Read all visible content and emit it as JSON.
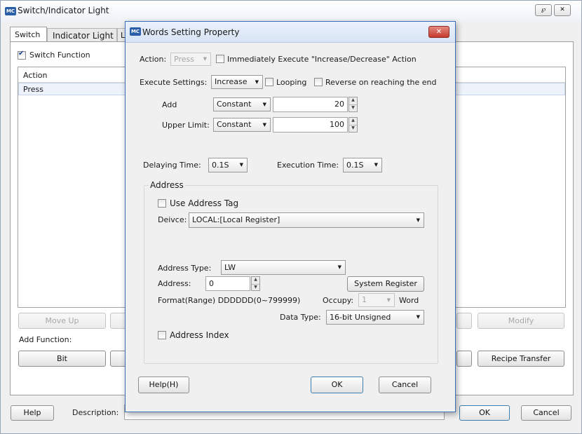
{
  "outer": {
    "logo": "MC",
    "title": "Switch/Indicator Light",
    "tabs": [
      "Switch",
      "Indicator Light",
      "L"
    ],
    "switch_function": "Switch Function",
    "table_header": "Action",
    "table_row": "Press",
    "move_up": "Move Up",
    "modify": "Modify",
    "add_function": "Add Function:",
    "bit": "Bit",
    "recipe_transfer": "Recipe Transfer",
    "help": "Help",
    "description": "Description:",
    "ok": "OK",
    "cancel": "Cancel"
  },
  "dialog": {
    "logo": "MC",
    "title": "Words Setting Property",
    "action_label": "Action:",
    "action_value": "Press",
    "immediately": "Immediately Execute \"Increase/Decrease\" Action",
    "execute_settings_label": "Execute Settings:",
    "execute_settings_value": "Increase",
    "looping": "Looping",
    "reverse": "Reverse on reaching the end",
    "add_label": "Add",
    "add_mode": "Constant",
    "add_value": "20",
    "upper_label": "Upper Limit:",
    "upper_mode": "Constant",
    "upper_value": "100",
    "delaying_label": "Delaying Time:",
    "delaying_value": "0.1S",
    "execution_label": "Execution Time:",
    "execution_value": "0.1S",
    "address_group": "Address",
    "use_address_tag": "Use Address Tag",
    "device_label": "Deivce:",
    "device_value": "LOCAL:[Local Register]",
    "address_type_label": "Address Type:",
    "address_type_value": "LW",
    "address_label": "Address:",
    "address_value": "0",
    "system_register": "System Register",
    "format_text": "Format(Range)  DDDDDD(0~799999)",
    "occupy_label": "Occupy:",
    "occupy_value": "1",
    "word": "Word",
    "data_type_label": "Data Type:",
    "data_type_value": "16-bit Unsigned",
    "address_index": "Address Index",
    "help": "Help(H)",
    "ok": "OK",
    "cancel": "Cancel"
  },
  "icons": [
    "pin-icon",
    "close-icon",
    "chevron-down-icon",
    "spin-up-icon",
    "spin-down-icon",
    "checkmark-icon"
  ],
  "colors": {
    "dialog_border": "#3a6fb8",
    "selected_row": "#e8f0fb",
    "close_button": "#c9443a"
  }
}
